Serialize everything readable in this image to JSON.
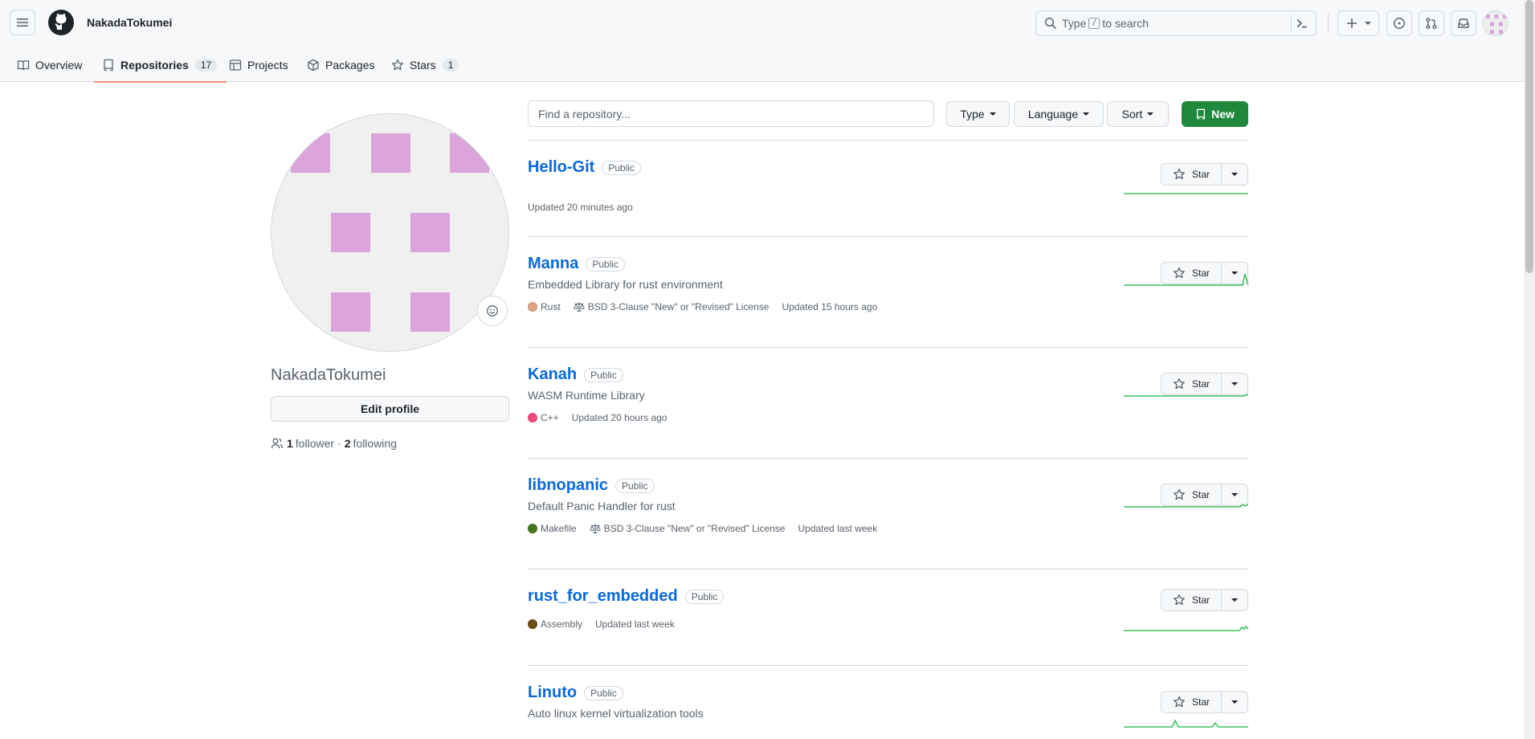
{
  "header": {
    "owner": "NakadaTokumei",
    "search_before": "Type",
    "search_key": "/",
    "search_after": "to search"
  },
  "tabs": [
    {
      "label": "Overview",
      "icon": "book-icon"
    },
    {
      "label": "Repositories",
      "count": "17",
      "icon": "repo-icon"
    },
    {
      "label": "Projects",
      "icon": "table-icon"
    },
    {
      "label": "Packages",
      "icon": "package-icon"
    },
    {
      "label": "Stars",
      "count": "1",
      "icon": "star-icon"
    }
  ],
  "profile": {
    "username": "NakadaTokumei",
    "edit_label": "Edit profile",
    "followers_count": "1",
    "followers_label": "follower",
    "separator": "·",
    "following_count": "2",
    "following_label": "following"
  },
  "filters": {
    "find_placeholder": "Find a repository...",
    "type_label": "Type",
    "language_label": "Language",
    "sort_label": "Sort",
    "new_label": "New"
  },
  "repos": [
    {
      "name": "Hello-Git",
      "visibility": "Public",
      "description": "",
      "language": "",
      "lang_color": "",
      "license": "",
      "updated": "Updated 20 minutes ago",
      "star_label": "Star"
    },
    {
      "name": "Manna",
      "visibility": "Public",
      "description": "Embedded Library for rust environment",
      "language": "Rust",
      "lang_color": "#dea584",
      "license": "BSD 3-Clause \"New\" or \"Revised\" License",
      "updated": "Updated 15 hours ago",
      "star_label": "Star"
    },
    {
      "name": "Kanah",
      "visibility": "Public",
      "description": "WASM Runtime Library",
      "language": "C++",
      "lang_color": "#f34b7d",
      "license": "",
      "updated": "Updated 20 hours ago",
      "star_label": "Star"
    },
    {
      "name": "libnopanic",
      "visibility": "Public",
      "description": "Default Panic Handler for rust",
      "language": "Makefile",
      "lang_color": "#427819",
      "license": "BSD 3-Clause \"New\" or \"Revised\" License",
      "updated": "Updated last week",
      "star_label": "Star"
    },
    {
      "name": "rust_for_embedded",
      "visibility": "Public",
      "description": "",
      "language": "Assembly",
      "lang_color": "#6e4c13",
      "license": "",
      "updated": "Updated last week",
      "star_label": "Star"
    },
    {
      "name": "Linuto",
      "visibility": "Public",
      "description": "Auto linux kernel virtualization tools",
      "language": "",
      "lang_color": "",
      "license": "",
      "updated": "",
      "star_label": "Star"
    }
  ],
  "colors": {
    "accent_green": "#1f883d",
    "link_blue": "#0969da",
    "tab_underline": "#fd8c73",
    "avatar_pink": "#dba4da",
    "sparkline": "#40c463"
  }
}
